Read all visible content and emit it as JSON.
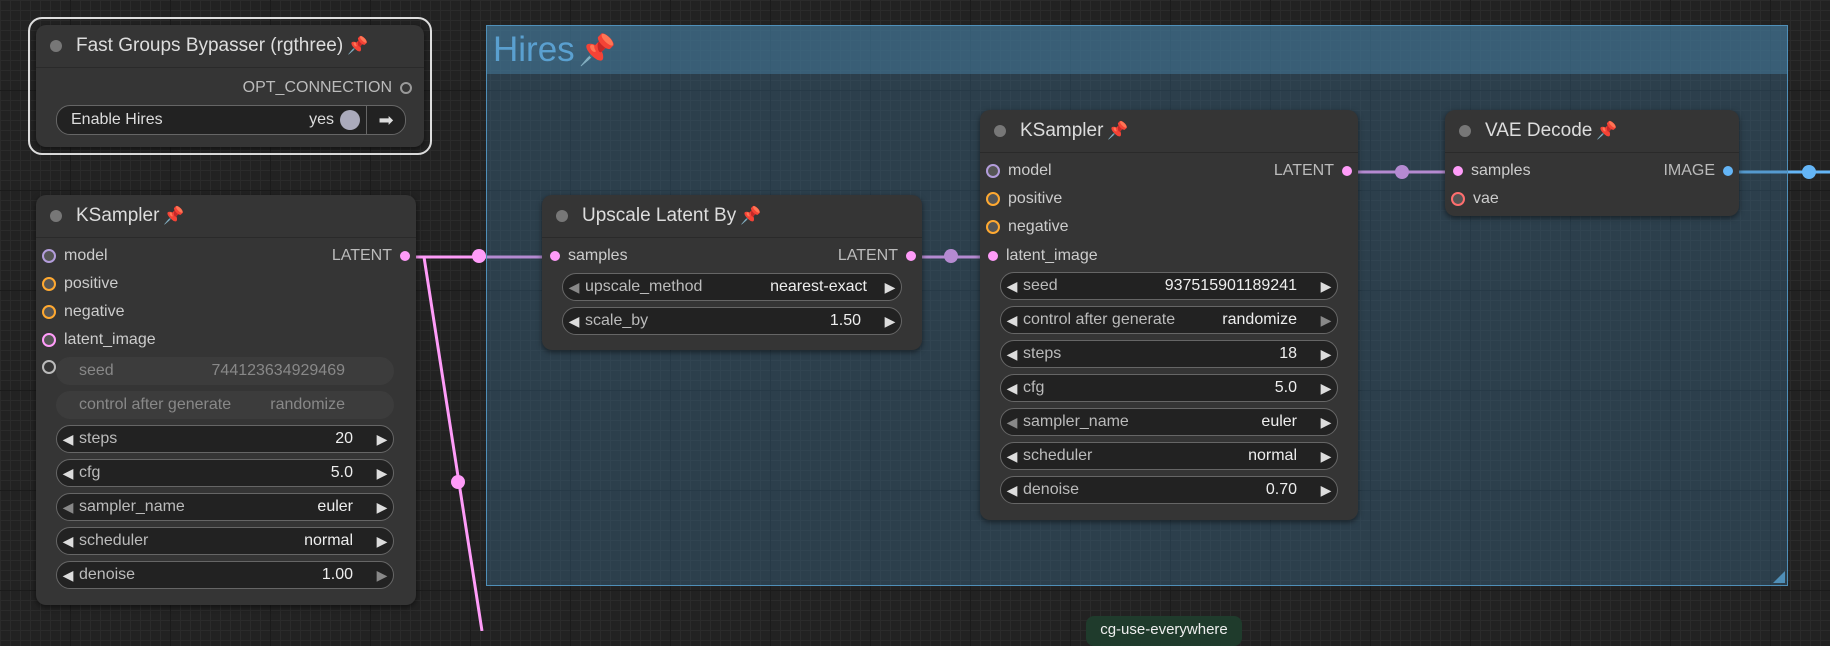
{
  "colors": {
    "model": "#b39ddb",
    "conditioning": "#ffa931",
    "latent": "#ff9cf9",
    "vae": "#ff6e6e",
    "image": "#64b5f6",
    "group": "#5aa0d0",
    "pin": "#e0426d"
  },
  "group": {
    "title": "Hires",
    "pin_icon": "pin-icon"
  },
  "fgb": {
    "title": "Fast Groups Bypasser (rgthree)",
    "output": "OPT_CONNECTION",
    "toggle": {
      "label": "Enable Hires",
      "value": "yes"
    }
  },
  "ksampler1": {
    "title": "KSampler",
    "inputs": [
      "model",
      "positive",
      "negative",
      "latent_image"
    ],
    "output": "LATENT",
    "seed": {
      "name": "seed",
      "value": "744123634929469"
    },
    "control": {
      "name": "control after generate",
      "value": "randomize"
    },
    "steps": {
      "name": "steps",
      "value": "20"
    },
    "cfg": {
      "name": "cfg",
      "value": "5.0"
    },
    "sampler": {
      "name": "sampler_name",
      "value": "euler"
    },
    "scheduler": {
      "name": "scheduler",
      "value": "normal"
    },
    "denoise": {
      "name": "denoise",
      "value": "1.00"
    }
  },
  "upscale": {
    "title": "Upscale Latent By",
    "input": "samples",
    "output": "LATENT",
    "method": {
      "name": "upscale_method",
      "value": "nearest-exact"
    },
    "scale": {
      "name": "scale_by",
      "value": "1.50"
    }
  },
  "ksampler2": {
    "title": "KSampler",
    "inputs": [
      "model",
      "positive",
      "negative",
      "latent_image"
    ],
    "output": "LATENT",
    "seed": {
      "name": "seed",
      "value": "937515901189241"
    },
    "control": {
      "name": "control after generate",
      "value": "randomize"
    },
    "steps": {
      "name": "steps",
      "value": "18"
    },
    "cfg": {
      "name": "cfg",
      "value": "5.0"
    },
    "sampler": {
      "name": "sampler_name",
      "value": "euler"
    },
    "scheduler": {
      "name": "scheduler",
      "value": "normal"
    },
    "denoise": {
      "name": "denoise",
      "value": "0.70"
    }
  },
  "vae": {
    "title": "VAE Decode",
    "inputs": [
      "samples",
      "vae"
    ],
    "output": "IMAGE"
  },
  "badge": {
    "text": "cg-use-everywhere"
  }
}
